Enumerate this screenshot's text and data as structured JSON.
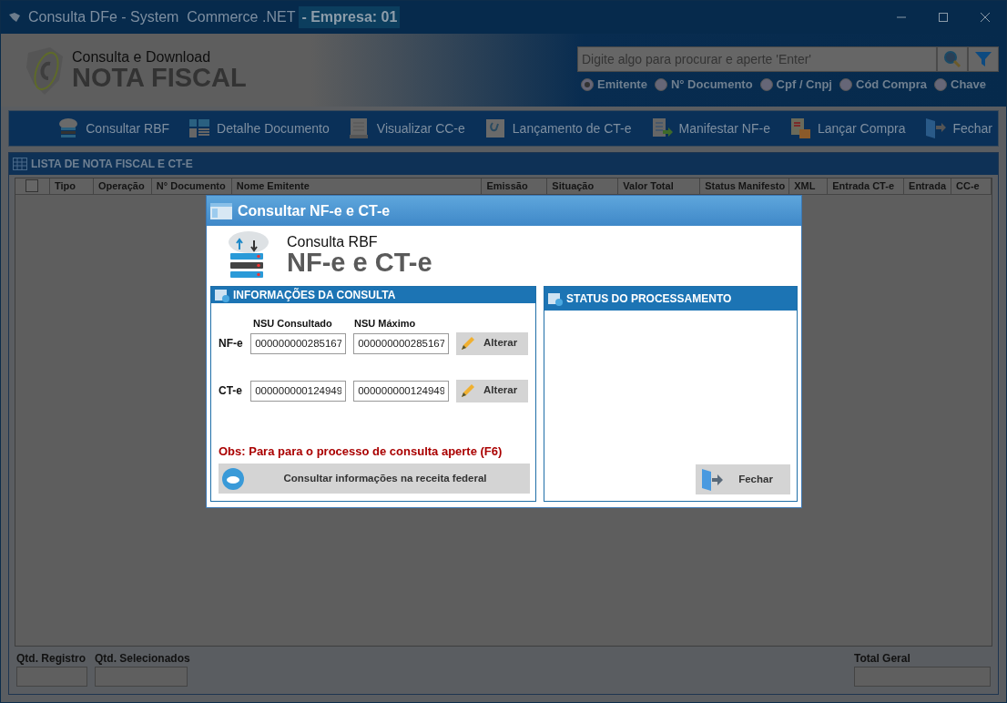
{
  "window": {
    "title": "Consulta DFe - System  Commerce .NET",
    "company": "- Empresa: 01"
  },
  "header": {
    "subtitle": "Consulta e Download",
    "title": "NOTA FISCAL",
    "search": {
      "placeholder": "Digite algo para procurar e aperte 'Enter'"
    },
    "search_options": [
      {
        "label": "Emitente",
        "selected": true
      },
      {
        "label": "N° Documento",
        "selected": false
      },
      {
        "label": "Cpf / Cnpj",
        "selected": false
      },
      {
        "label": "Cód Compra",
        "selected": false
      },
      {
        "label": "Chave",
        "selected": false
      }
    ]
  },
  "toolbar": [
    {
      "label": "Consultar RBF",
      "kind": "cloud"
    },
    {
      "label": "Detalhe Documento",
      "kind": "detail"
    },
    {
      "label": "Visualizar CC-e",
      "kind": "document"
    },
    {
      "label": "Lançamento de CT-e",
      "kind": "ct"
    },
    {
      "label": "Manifestar NF-e",
      "kind": "manifest"
    },
    {
      "label": "Lançar Compra",
      "kind": "purchase"
    },
    {
      "label": "Fechar",
      "kind": "exit"
    }
  ],
  "list": {
    "title": "LISTA DE NOTA FISCAL E CT-E",
    "select_all": {
      "checked": false
    },
    "columns": [
      "Tipo",
      "Operação",
      "N° Documento",
      "Nome Emitente",
      "Emissão",
      "Situação",
      "Valor Total",
      "Status Manifesto",
      "XML",
      "Entrada CT-e",
      "Entrada",
      "CC-e"
    ]
  },
  "footer": [
    {
      "label": "Qtd. Registro"
    },
    {
      "label": "Qtd. Selecionados"
    },
    {
      "label": "Total Geral"
    }
  ],
  "dialog": {
    "title": "Consultar NF-e e CT-e",
    "caption": "Consulta RBF",
    "heading": "NF-e e CT-e",
    "info_panel": {
      "title": "INFORMAÇÕES DA CONSULTA",
      "columns": [
        "NSU Consultado",
        "NSU Máximo"
      ],
      "rows": [
        {
          "label": "NF-e",
          "consulted": "000000000285167",
          "max": "000000000285167",
          "button": "Alterar"
        },
        {
          "label": "CT-e",
          "consulted": "000000000124949",
          "max": "000000000124949",
          "button": "Alterar"
        }
      ],
      "note": "Obs: Para para o processo de consulta aperte (F6)",
      "action": "Consultar informações na receita federal"
    },
    "status_panel": {
      "title": "STATUS DO PROCESSAMENTO",
      "close": "Fechar"
    }
  }
}
